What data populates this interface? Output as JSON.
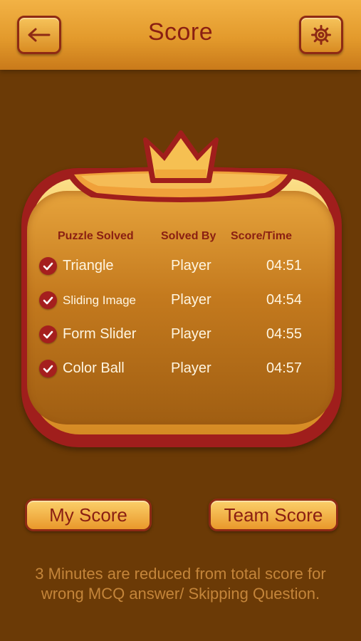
{
  "header": {
    "title": "Score",
    "back_icon": "back-arrow-icon",
    "settings_icon": "gear-icon"
  },
  "table": {
    "headers": [
      "Puzzle Solved",
      "Solved By",
      "Score/Time"
    ],
    "rows": [
      {
        "puzzle": "Triangle",
        "solved_by": "Player",
        "time": "04:51"
      },
      {
        "puzzle": "Sliding Image",
        "solved_by": "Player",
        "time": "04:54"
      },
      {
        "puzzle": "Form Slider",
        "solved_by": "Player",
        "time": "04:55"
      },
      {
        "puzzle": "Color Ball",
        "solved_by": "Player",
        "time": "04:57"
      }
    ]
  },
  "buttons": {
    "my_score": "My Score",
    "team_score": "Team Score"
  },
  "note": "3 Minutes are reduced from total score for wrong MCQ answer/ Skipping Question.",
  "colors": {
    "background": "#6b3a06",
    "header_bar": "#e39a2c",
    "card_border": "#a01e1c",
    "title_text": "#8a1f12",
    "row_text": "#fff6e2",
    "note_text": "#c4853a"
  }
}
